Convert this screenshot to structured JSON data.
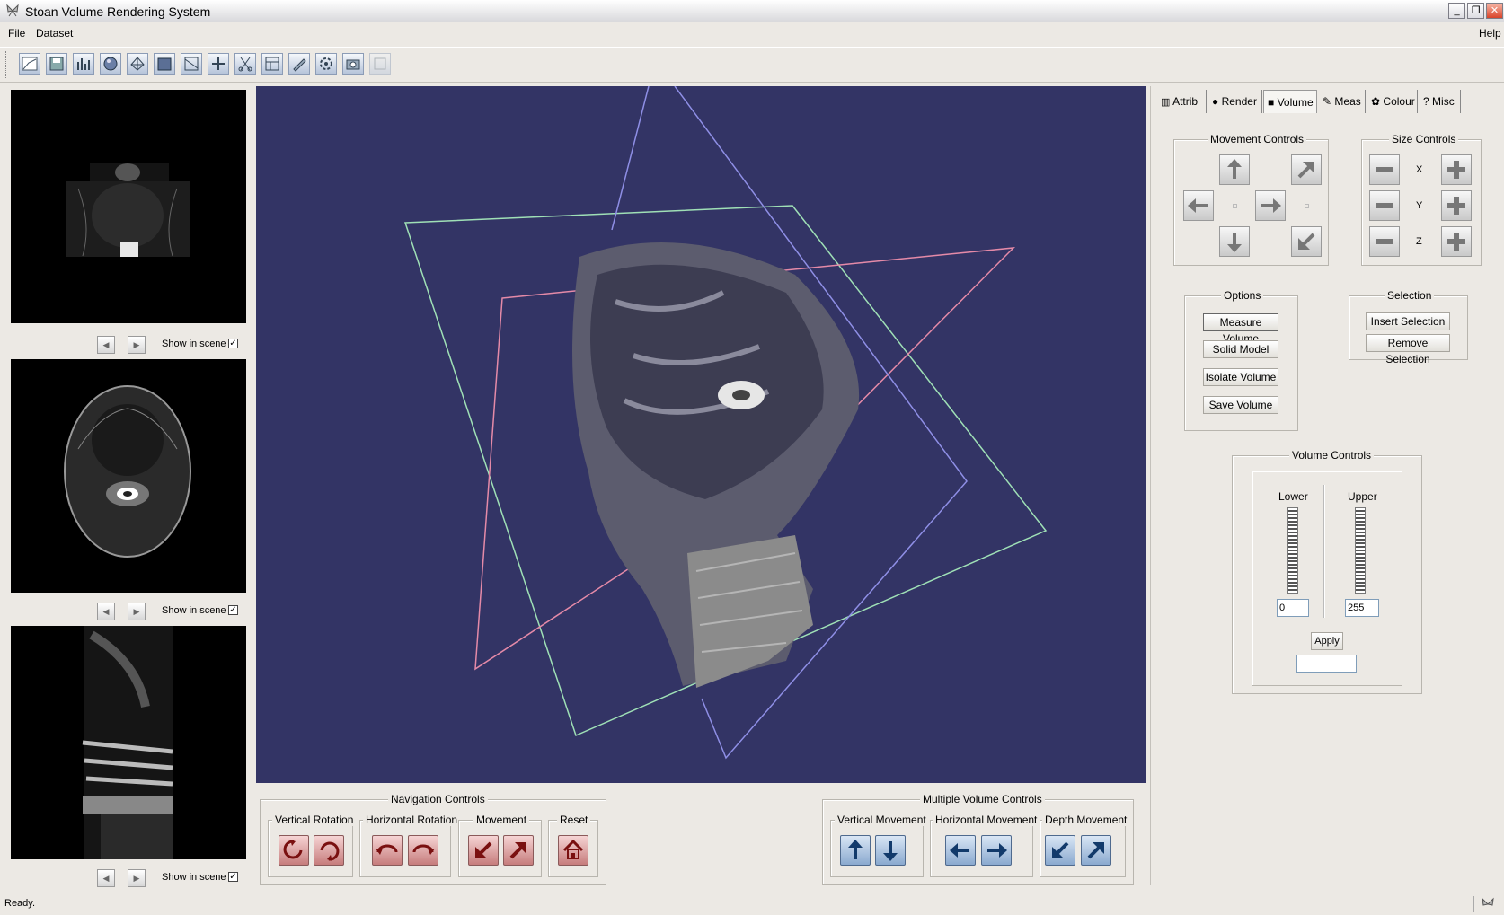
{
  "window": {
    "title": "Stoan Volume Rendering System"
  },
  "menu": {
    "file": "File",
    "dataset": "Dataset",
    "help": "Help"
  },
  "toolbar": {
    "icons": [
      "open-image-icon",
      "save-icon",
      "histogram-icon",
      "sphere-icon",
      "mesh-icon",
      "cube-icon",
      "slice-icon",
      "grid-icon",
      "cut-icon",
      "panel-icon",
      "pencil-icon",
      "gear-icon",
      "camera-icon",
      "disabled-tool-icon"
    ]
  },
  "slices": [
    {
      "show_label": "Show in scene"
    },
    {
      "show_label": "Show in scene"
    },
    {
      "show_label": "Show in scene"
    }
  ],
  "navigation": {
    "title": "Navigation Controls",
    "vertical_rotation": "Vertical Rotation",
    "horizontal_rotation": "Horizontal Rotation",
    "movement": "Movement",
    "reset": "Reset"
  },
  "multi": {
    "title": "Multiple Volume Controls",
    "vertical_movement": "Vertical Movement",
    "horizontal_movement": "Horizontal Movement",
    "depth_movement": "Depth Movement"
  },
  "tabs": [
    "Attrib",
    "Render",
    "Volume",
    "Meas",
    "Colour",
    "Misc"
  ],
  "movement_controls": {
    "title": "Movement Controls"
  },
  "size_controls": {
    "title": "Size Controls",
    "x": "X",
    "y": "Y",
    "z": "Z"
  },
  "options": {
    "title": "Options",
    "measure": "Measure Volume",
    "solid": "Solid Model",
    "isolate": "Isolate Volume",
    "save": "Save Volume"
  },
  "selection": {
    "title": "Selection",
    "insert": "Insert Selection",
    "remove": "Remove Selection"
  },
  "volume_controls": {
    "title": "Volume Controls",
    "lower": "Lower",
    "upper": "Upper",
    "lower_value": "0",
    "upper_value": "255",
    "apply": "Apply",
    "result": ""
  },
  "status": {
    "text": "Ready."
  },
  "colors": {
    "viewport_bg": "#333465",
    "plane_green": "#9fe0b6",
    "plane_pink": "#e58aa8",
    "plane_blue": "#8f8fe6"
  }
}
